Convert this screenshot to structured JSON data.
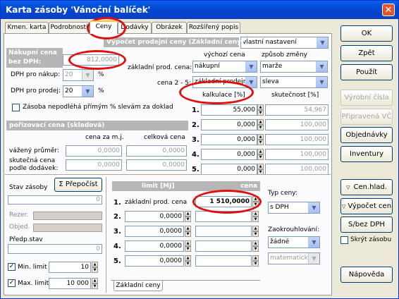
{
  "window": {
    "title": "Karta zásoby 'Vánoční balíček'"
  },
  "tabs": [
    "Kmen. karta",
    "Podrobnosti",
    "Ceny",
    "Dodávky",
    "Obrázek",
    "Rozšířený popis"
  ],
  "top_select": "vlastní nastavení",
  "left": {
    "purchase_header": "Nákupní cena bez DPH:",
    "purchase_l1": "Nákupní cena",
    "purchase_l2": "bez DPH:",
    "purchase_value": "812,0000",
    "vat_purchase_label": "DPH pro nákup:",
    "vat_purchase_value": "20",
    "vat_sale_label": "DPH pro prodej:",
    "vat_sale_value": "20",
    "pct": "%",
    "checkbox_discount": "Zásoba nepodléhá přímým % slevám za doklad",
    "acq_header": "pořizovací cena  (skladová)",
    "col_unit": "cena za m.j.",
    "col_total": "celková cena",
    "weighted": "vážený průměr:",
    "actual_l1": "skutečná cena",
    "actual_l2": "podle dodávek:",
    "weighted_unit": "0,0000",
    "weighted_total": "0,0000",
    "actual_unit": "0,0000",
    "actual_total": "0,0000"
  },
  "calc": {
    "header": "Výpočet prodejní ceny (Základní ceny)",
    "col_source": "výchozí cena",
    "col_method": "způsob změny",
    "base_label": "základní prod. cena:",
    "base_source": "nákupní",
    "base_method": "marže",
    "price_label": "cena 2 - 5:",
    "price_source": "základní prodejní",
    "price_method": "sleva",
    "col_calc": "kalkulace [%]",
    "col_actual": "skutečnost [%]",
    "rows": [
      {
        "n": "1.",
        "calc": "55,000",
        "actual": "54,967"
      },
      {
        "n": "2.",
        "calc": "0,000",
        "actual": "100,000"
      },
      {
        "n": "3.",
        "calc": "0,000",
        "actual": "100,000"
      },
      {
        "n": "4.",
        "calc": "0,000",
        "actual": "100,000"
      },
      {
        "n": "5.",
        "calc": "0,000",
        "actual": "100,000"
      }
    ]
  },
  "stock": {
    "label": "Stav zásoby",
    "recalc": "Σ  Přepočíst",
    "value": "0",
    "reserved": "Rezer.",
    "reserved_value": "0",
    "ordered": "Objed.",
    "ordered_value": "0",
    "expected": "Předp.stav",
    "expected_value": "0",
    "min_label": "Min. limit",
    "min_value": "10",
    "max_label": "Max. limit",
    "max_value": "10 000"
  },
  "limits": {
    "col_limit": "limit [MJ]",
    "col_price": "cena",
    "row1_label": "základní prod. cena",
    "rows": [
      {
        "n": "1.",
        "limit": "",
        "price": "1 510,0000"
      },
      {
        "n": "2.",
        "limit": "0,0000",
        "price": ""
      },
      {
        "n": "3.",
        "limit": "0,0000",
        "price": ""
      },
      {
        "n": "4.",
        "limit": "0,0000",
        "price": ""
      },
      {
        "n": "5.",
        "limit": "0,0000",
        "price": ""
      }
    ],
    "bottom_tab": "Základní ceny"
  },
  "price_type": {
    "label": "Typ ceny:",
    "value": "s DPH",
    "rounding_label": "Zaokrouhlování:",
    "rounding_value": "žádné",
    "rounding_method": "matematicky"
  },
  "buttons": {
    "ok": "OK",
    "back": "Zpět",
    "apply": "Použít",
    "serials": "Výrobní čísla",
    "prepared": "Připravená VČ",
    "orders": "Objednávky",
    "inventory": "Inventury",
    "price_levels": "Cen.hlad.",
    "calc_price": "Výpočet cen",
    "vat_toggle": "S/bez DPH",
    "hide_stock": "Skrýt zásobu",
    "help": "Nápověda"
  },
  "colors": {
    "title_blue": "#0349d4",
    "highlight_red": "#e01010",
    "header_gray": "#b6b6b6"
  }
}
